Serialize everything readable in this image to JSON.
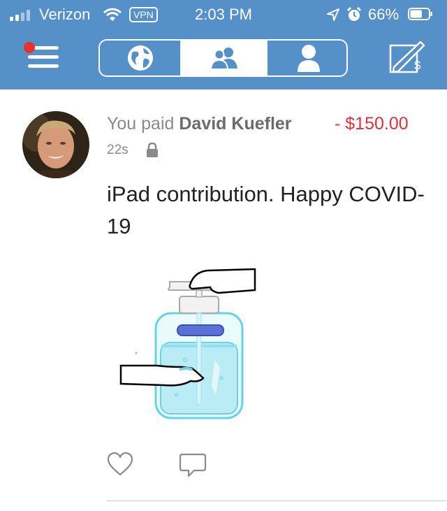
{
  "status_bar": {
    "carrier": "Verizon",
    "vpn": "VPN",
    "time": "2:03 PM",
    "battery_percent": "66%",
    "battery_level": 0.66
  },
  "nav": {
    "menu_icon": "hamburger-menu-icon",
    "notification_dot": true,
    "tabs": [
      {
        "icon": "globe-icon",
        "selected": false
      },
      {
        "icon": "friends-icon",
        "selected": true
      },
      {
        "icon": "person-icon",
        "selected": false
      }
    ],
    "pay_request_icon": "pay-request-icon"
  },
  "transaction": {
    "prefix": "You paid",
    "recipient": "David Kuefler",
    "amount": "- $150.00",
    "time_ago": "22s",
    "privacy_icon": "lock-icon",
    "note": "iPad contribution.  Happy COVID-19",
    "media": "hand-sanitizer-illustration",
    "actions": [
      {
        "icon": "heart-icon"
      },
      {
        "icon": "comment-icon"
      }
    ]
  },
  "colors": {
    "header": "#5590c8",
    "amount": "#d9343a",
    "notification_dot": "#e8322b"
  }
}
